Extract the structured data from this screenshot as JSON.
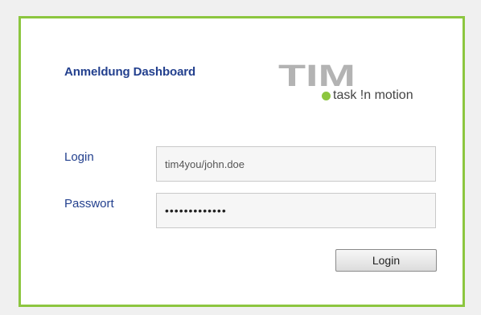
{
  "page": {
    "title": "Anmeldung Dashboard"
  },
  "logo": {
    "mark_text": "TIM",
    "tagline": "task !n motion",
    "mark_color": "#b3b3b3",
    "dot_color": "#8cc63f"
  },
  "form": {
    "login_label": "Login",
    "login_value": "tim4you/john.doe",
    "password_label": "Passwort",
    "password_value": "•••••••••••••",
    "submit_label": "Login"
  },
  "colors": {
    "panel_border": "#8cc63f",
    "label_text": "#23408e",
    "page_background": "#f0f0f0"
  }
}
